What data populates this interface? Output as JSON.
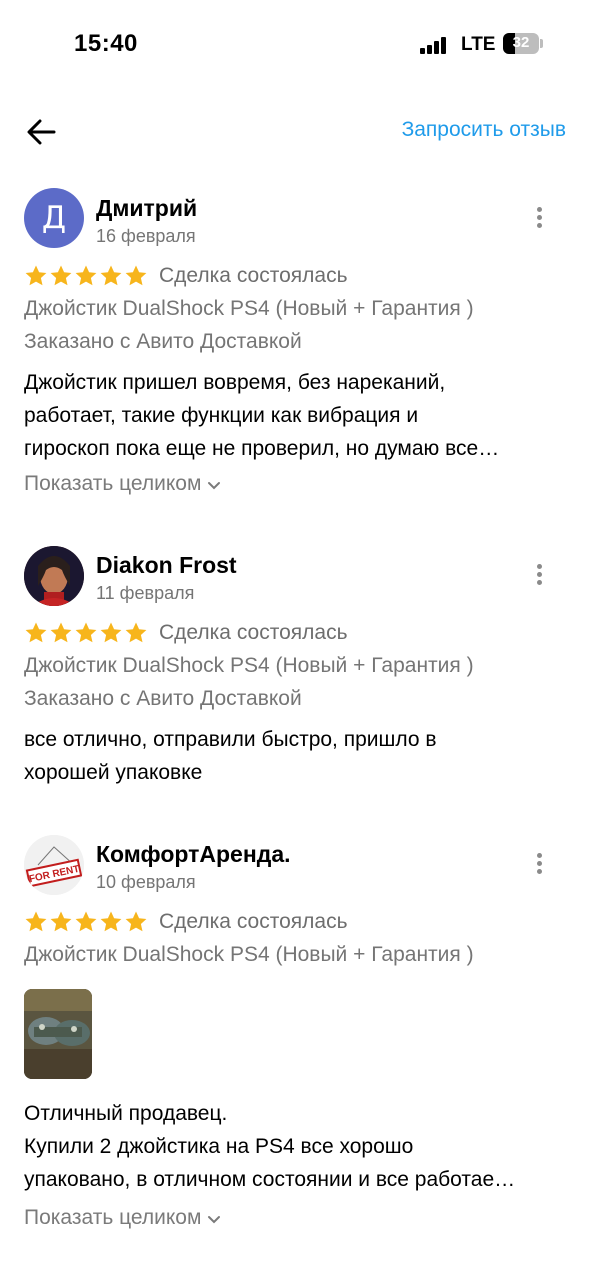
{
  "status_bar": {
    "time": "15:40",
    "network": "LTE",
    "battery": "32"
  },
  "header": {
    "back_icon": "arrow-left-icon",
    "request_review": "Запросить отзыв"
  },
  "colors": {
    "link": "#1f9bea",
    "star": "#f7b51c",
    "avatar_letter_bg": "#5c6bc8",
    "secondary_text": "#757575"
  },
  "reviews": [
    {
      "avatar_letter": "Д",
      "author": "Дмитрий",
      "date": "16 февраля",
      "rating": 5,
      "status": "Сделка состоялась",
      "item": "Джойстик DualShock PS4 (Новый + Гарантия )",
      "delivery": "Заказано с Авито Доставкой",
      "text_lines": [
        "Джойстик пришел вовремя, без нареканий,",
        "работает, такие функции как вибрация и",
        "гироскоп пока еще не проверил, но думаю все…"
      ],
      "show_full": "Показать целиком"
    },
    {
      "author": "Diakon Frost",
      "date": "11 февраля",
      "rating": 5,
      "status": "Сделка состоялась",
      "item": "Джойстик DualShock PS4 (Новый + Гарантия )",
      "delivery": "Заказано с Авито Доставкой",
      "text_lines": [
        "все отлично, отправили быстро, пришло в",
        "хорошей упаковке"
      ]
    },
    {
      "avatar_sign": "FOR RENT",
      "author": "КомфортАренда.",
      "date": "10 февраля",
      "rating": 5,
      "status": "Сделка состоялась",
      "item": "Джойстик DualShock PS4 (Новый + Гарантия )",
      "text_lines": [
        "Отличный продавец.",
        "Купили 2 джойстика на PS4 все хорошо",
        "упаковано, в отличном состоянии и все работае…"
      ],
      "show_full": "Показать целиком"
    }
  ]
}
